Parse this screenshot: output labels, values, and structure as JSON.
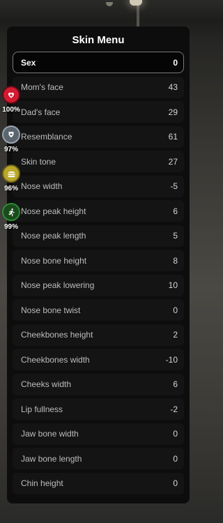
{
  "menu": {
    "title": "Skin Menu",
    "items": [
      {
        "label": "Sex",
        "value": "0"
      },
      {
        "label": "Mom's face",
        "value": "43"
      },
      {
        "label": "Dad's face",
        "value": "29"
      },
      {
        "label": "Resemblance",
        "value": "61"
      },
      {
        "label": "Skin tone",
        "value": "27"
      },
      {
        "label": "Nose width",
        "value": "-5"
      },
      {
        "label": "Nose peak height",
        "value": "6"
      },
      {
        "label": "Nose peak length",
        "value": "5"
      },
      {
        "label": "Nose bone height",
        "value": "8"
      },
      {
        "label": "Nose peak lowering",
        "value": "10"
      },
      {
        "label": "Nose bone twist",
        "value": "0"
      },
      {
        "label": "Cheekbones height",
        "value": "2"
      },
      {
        "label": "Cheekbones width",
        "value": "-10"
      },
      {
        "label": "Cheeks width",
        "value": "6"
      },
      {
        "label": "Lip fullness",
        "value": "-2"
      },
      {
        "label": "Jaw bone width",
        "value": "0"
      },
      {
        "label": "Jaw bone length",
        "value": "0"
      },
      {
        "label": "Chin height",
        "value": "0"
      }
    ],
    "selected_index": 0
  },
  "hud": {
    "health": {
      "value": "100%",
      "icon": "heart-icon",
      "color": "#d21a30"
    },
    "armor": {
      "value": "97%",
      "icon": "shield-icon",
      "color": "#5a6570"
    },
    "hunger": {
      "value": "96%",
      "icon": "burger-icon",
      "color": "#b9a82a"
    },
    "stamina": {
      "value": "99%",
      "icon": "running-icon",
      "color": "#2f8a33"
    }
  }
}
